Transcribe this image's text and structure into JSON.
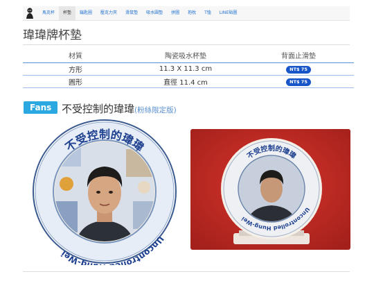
{
  "nav": {
    "items": [
      {
        "label": "馬克杯",
        "active": false
      },
      {
        "label": "杯墊",
        "active": true
      },
      {
        "label": "鑰匙圈",
        "active": false
      },
      {
        "label": "壓克力夾",
        "active": false
      },
      {
        "label": "滑鼠墊",
        "active": false
      },
      {
        "label": "吸水圓墊",
        "active": false
      },
      {
        "label": "拼圖",
        "active": false
      },
      {
        "label": "抱枕",
        "active": false
      },
      {
        "label": "T恤",
        "active": false
      },
      {
        "label": "LINE貼圖",
        "active": false
      }
    ]
  },
  "page": {
    "title": "瑋瑋牌杯墊"
  },
  "spec_table": {
    "headers": [
      "材質",
      "陶瓷吸水杯墊",
      "背面止滑墊"
    ],
    "rows": [
      {
        "name": "方形",
        "size": "11.3 X 11.3 cm",
        "price": "NT$ 75"
      },
      {
        "name": "圓形",
        "size": "直徑 11.4 cm",
        "price": "NT$ 75"
      }
    ]
  },
  "fans": {
    "tag": "Fans",
    "title": "不受控制的瑋瑋",
    "subtitle": "(粉絲限定版)"
  },
  "coaster": {
    "top_text": "不受控制的瑋瑋",
    "bottom_text": "Uncontrolled Hung-Wei"
  },
  "colors": {
    "link": "#1e6fd0",
    "badge": "#1756c9",
    "fans_tag": "#2ba8e0",
    "coaster_ring": "#e9eef6",
    "coaster_text": "#1d3f8f",
    "photo_bg": "#c8251f"
  }
}
